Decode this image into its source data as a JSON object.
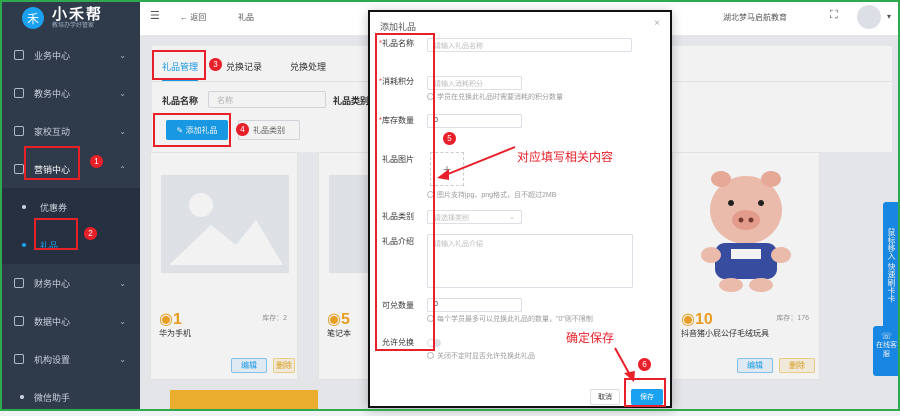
{
  "app": {
    "brand": "小禾帮",
    "brand_sub": "教培办学好管家",
    "org": "湖北梦马启航教育"
  },
  "topbar": {
    "back_label": "返回",
    "crumb": "礼品"
  },
  "sidebar": {
    "items": [
      {
        "label": "业务中心"
      },
      {
        "label": "教务中心"
      },
      {
        "label": "家校互动"
      },
      {
        "label": "营销中心"
      },
      {
        "label": "财务中心"
      },
      {
        "label": "数据中心"
      },
      {
        "label": "机构设置"
      },
      {
        "label": "微信助手"
      }
    ],
    "sub_items": [
      {
        "label": "优惠券"
      },
      {
        "label": "礼品"
      }
    ]
  },
  "tabs": [
    {
      "label": "礼品管理"
    },
    {
      "label": "兑换记录"
    },
    {
      "label": "兑换处理"
    }
  ],
  "filter": {
    "name_label": "礼品名称",
    "name_placeholder": "名称",
    "type_label": "礼品类别",
    "add_button": "添加礼品",
    "category_button": "礼品类别"
  },
  "cards": [
    {
      "points": "1",
      "stock": "库存：2",
      "name": "华为手机",
      "edit": "编辑",
      "delete": "删除"
    },
    {
      "points": "5",
      "name": "笔记本"
    },
    {
      "points": "10",
      "stock": "库存：176",
      "name": "抖音猪小屁公仔毛绒玩具",
      "edit": "编辑",
      "delete": "删除"
    }
  ],
  "side_float": {
    "text": "鼠标移入 快速刷卡卡",
    "online": "在线客服"
  },
  "modal": {
    "title": "添加礼品",
    "fields": {
      "name": {
        "label": "礼品名称",
        "placeholder": "请输入礼品名称"
      },
      "points": {
        "label": "消耗积分",
        "placeholder": "请输入消耗积分",
        "hint": "学员在兑换此礼品时需要消耗的积分数量"
      },
      "stock": {
        "label": "库存数量",
        "value": "0"
      },
      "image": {
        "label": "礼品图片",
        "hint": "图片支持jpg、png格式，且不超过2MB"
      },
      "category": {
        "label": "礼品类别",
        "placeholder": "请选择类别"
      },
      "intro": {
        "label": "礼品介绍",
        "placeholder": "请输入礼品介绍"
      },
      "exchangeable": {
        "label": "可兑数量",
        "value": "0",
        "hint": "每个学员最多可以兑换此礼品的数量，\"0\"则不限制"
      },
      "allow": {
        "label": "允许兑换",
        "hint": "关闭不定时显否允许兑换此礼品"
      }
    },
    "cancel": "取消",
    "save": "保存"
  },
  "annotations": {
    "n1": "1",
    "n2": "2",
    "n3": "3",
    "n4": "4",
    "n5": "5",
    "n6": "6",
    "fill_text": "对应填写相关内容",
    "save_text": "确定保存"
  },
  "colors": {
    "accent": "#1aa1f0",
    "sidebar": "#2f3a4b",
    "annotation": "#e8202a",
    "points": "#f6a623"
  }
}
